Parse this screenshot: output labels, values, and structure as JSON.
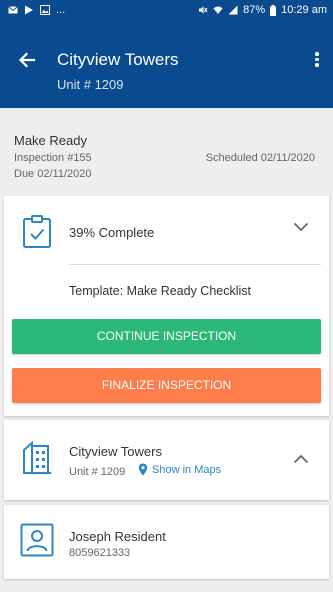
{
  "status_bar": {
    "left_dots": "...",
    "battery": "87%",
    "time": "10:29 am"
  },
  "header": {
    "title": "Cityview Towers",
    "subtitle": "Unit # 1209"
  },
  "inspection": {
    "name": "Make Ready",
    "number": "Inspection #155",
    "due": "Due 02/11/2020",
    "scheduled": "Scheduled 02/11/2020"
  },
  "progress_card": {
    "progress_label": "39% Complete",
    "progress_fraction": 0.39,
    "template": "Template: Make Ready Checklist",
    "continue_label": "CONTINUE INSPECTION",
    "finalize_label": "FINALIZE INSPECTION"
  },
  "property_card": {
    "title": "Cityview Towers",
    "unit": "Unit # 1209",
    "maps_link": "Show in Maps"
  },
  "resident_card": {
    "name": "Joseph Resident",
    "phone": "8059621333"
  },
  "colors": {
    "primary": "#0a4a8f",
    "continue": "#2cb877",
    "finalize": "#ff7c4b",
    "icon_blue": "#2d86c4"
  },
  "icons": [
    "back-arrow-icon",
    "more-vert-icon",
    "clipboard-check-icon",
    "chevron-down-icon",
    "building-icon",
    "location-pin-icon",
    "chevron-up-icon",
    "person-id-icon"
  ]
}
